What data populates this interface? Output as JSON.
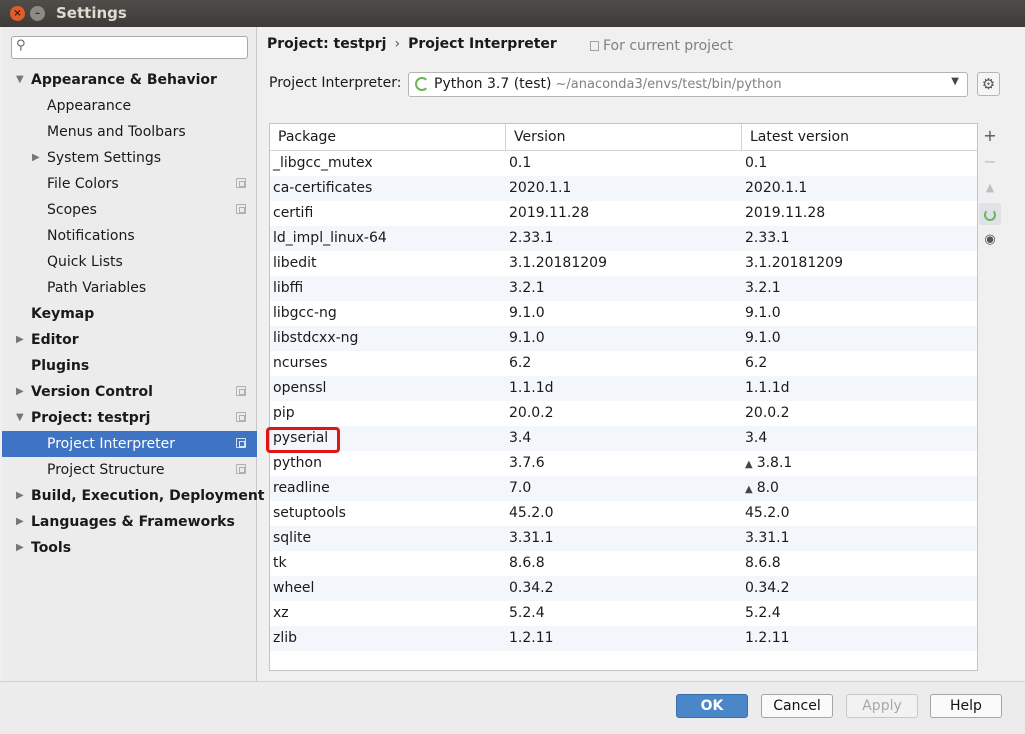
{
  "window": {
    "title": "Settings",
    "close_glyph": "×",
    "minimize_glyph": "–"
  },
  "sidebar": {
    "search": {
      "value": "",
      "placeholder": "",
      "icon": "search-icon",
      "glyph": "⚲"
    },
    "items": [
      {
        "label": "Appearance & Behavior",
        "bold": true,
        "arrow": "▼",
        "indent": 0,
        "copy": false
      },
      {
        "label": "Appearance",
        "bold": false,
        "arrow": "",
        "indent": 1,
        "copy": false
      },
      {
        "label": "Menus and Toolbars",
        "bold": false,
        "arrow": "",
        "indent": 1,
        "copy": false
      },
      {
        "label": "System Settings",
        "bold": false,
        "arrow": "▶",
        "indent": 1,
        "copy": false
      },
      {
        "label": "File Colors",
        "bold": false,
        "arrow": "",
        "indent": 1,
        "copy": true
      },
      {
        "label": "Scopes",
        "bold": false,
        "arrow": "",
        "indent": 1,
        "copy": true
      },
      {
        "label": "Notifications",
        "bold": false,
        "arrow": "",
        "indent": 1,
        "copy": false
      },
      {
        "label": "Quick Lists",
        "bold": false,
        "arrow": "",
        "indent": 1,
        "copy": false
      },
      {
        "label": "Path Variables",
        "bold": false,
        "arrow": "",
        "indent": 1,
        "copy": false
      },
      {
        "label": "Keymap",
        "bold": true,
        "arrow": "",
        "indent": 0,
        "copy": false
      },
      {
        "label": "Editor",
        "bold": true,
        "arrow": "▶",
        "indent": 0,
        "copy": false
      },
      {
        "label": "Plugins",
        "bold": true,
        "arrow": "",
        "indent": 0,
        "copy": false
      },
      {
        "label": "Version Control",
        "bold": true,
        "arrow": "▶",
        "indent": 0,
        "copy": true
      },
      {
        "label": "Project: testprj",
        "bold": true,
        "arrow": "▼",
        "indent": 0,
        "copy": true
      },
      {
        "label": "Project Interpreter",
        "bold": false,
        "arrow": "",
        "indent": 1,
        "copy": true,
        "selected": true
      },
      {
        "label": "Project Structure",
        "bold": false,
        "arrow": "",
        "indent": 1,
        "copy": true
      },
      {
        "label": "Build, Execution, Deployment",
        "bold": true,
        "arrow": "▶",
        "indent": 0,
        "copy": false
      },
      {
        "label": "Languages & Frameworks",
        "bold": true,
        "arrow": "▶",
        "indent": 0,
        "copy": false
      },
      {
        "label": "Tools",
        "bold": true,
        "arrow": "▶",
        "indent": 0,
        "copy": false
      }
    ]
  },
  "header": {
    "breadcrumb_project": "Project: testprj",
    "breadcrumb_separator": "›",
    "breadcrumb_page": "Project Interpreter",
    "for_current_project": "For current project"
  },
  "interpreter": {
    "label": "Project Interpreter:",
    "name": "Python 3.7 (test)",
    "path": "~/anaconda3/envs/test/bin/python",
    "caret": "▼",
    "gear_glyph": "⚙"
  },
  "table": {
    "columns": [
      "Package",
      "Version",
      "Latest version"
    ],
    "upgrade_glyph": "▲",
    "rows": [
      {
        "package": "_libgcc_mutex",
        "version": "0.1",
        "latest": "0.1",
        "upgrade": false
      },
      {
        "package": "ca-certificates",
        "version": "2020.1.1",
        "latest": "2020.1.1",
        "upgrade": false
      },
      {
        "package": "certifi",
        "version": "2019.11.28",
        "latest": "2019.11.28",
        "upgrade": false
      },
      {
        "package": "ld_impl_linux-64",
        "version": "2.33.1",
        "latest": "2.33.1",
        "upgrade": false
      },
      {
        "package": "libedit",
        "version": "3.1.20181209",
        "latest": "3.1.20181209",
        "upgrade": false
      },
      {
        "package": "libffi",
        "version": "3.2.1",
        "latest": "3.2.1",
        "upgrade": false
      },
      {
        "package": "libgcc-ng",
        "version": "9.1.0",
        "latest": "9.1.0",
        "upgrade": false
      },
      {
        "package": "libstdcxx-ng",
        "version": "9.1.0",
        "latest": "9.1.0",
        "upgrade": false
      },
      {
        "package": "ncurses",
        "version": "6.2",
        "latest": "6.2",
        "upgrade": false
      },
      {
        "package": "openssl",
        "version": "1.1.1d",
        "latest": "1.1.1d",
        "upgrade": false
      },
      {
        "package": "pip",
        "version": "20.0.2",
        "latest": "20.0.2",
        "upgrade": false
      },
      {
        "package": "pyserial",
        "version": "3.4",
        "latest": "3.4",
        "upgrade": false,
        "highlighted": true
      },
      {
        "package": "python",
        "version": "3.7.6",
        "latest": "3.8.1",
        "upgrade": true
      },
      {
        "package": "readline",
        "version": "7.0",
        "latest": "8.0",
        "upgrade": true
      },
      {
        "package": "setuptools",
        "version": "45.2.0",
        "latest": "45.2.0",
        "upgrade": false
      },
      {
        "package": "sqlite",
        "version": "3.31.1",
        "latest": "3.31.1",
        "upgrade": false
      },
      {
        "package": "tk",
        "version": "8.6.8",
        "latest": "8.6.8",
        "upgrade": false
      },
      {
        "package": "wheel",
        "version": "0.34.2",
        "latest": "0.34.2",
        "upgrade": false
      },
      {
        "package": "xz",
        "version": "5.2.4",
        "latest": "5.2.4",
        "upgrade": false
      },
      {
        "package": "zlib",
        "version": "1.2.11",
        "latest": "1.2.11",
        "upgrade": false
      }
    ]
  },
  "table_tools": {
    "add_glyph": "+",
    "remove_glyph": "−",
    "upgrade_glyph": "▲",
    "show_early_glyph": "◉"
  },
  "footer": {
    "ok": "OK",
    "cancel": "Cancel",
    "apply": "Apply",
    "help": "Help"
  },
  "colors": {
    "selection": "#3f74c4",
    "ok_button": "#4a86c8",
    "highlight_box": "#e01616",
    "spinner": "#6cb55a"
  }
}
